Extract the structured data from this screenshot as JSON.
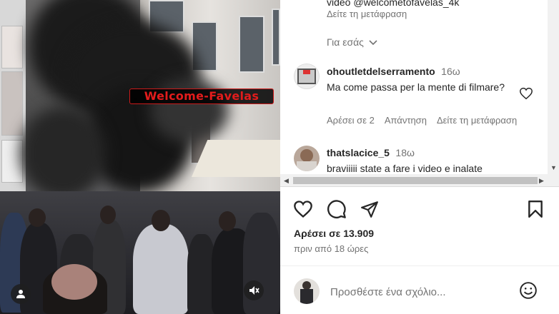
{
  "video": {
    "watermark": "Welcome-Favelas"
  },
  "caption": {
    "tail_text": "video @welcometofavelas_4k",
    "see_translation": "Δείτε τη μετάφραση"
  },
  "for_you": {
    "label": "Για εσάς"
  },
  "comments": [
    {
      "username": "ohoutletdelserramento",
      "time": "16ω",
      "text": "Ma come passa per la mente di filmare?",
      "likes": "Αρέσει σε 2",
      "reply": "Απάντηση",
      "see_translation": "Δείτε τη μετάφραση"
    },
    {
      "username": "thatslacice_5",
      "time": "18ω",
      "text": "braviiiii state a fare i video e inalate"
    }
  ],
  "post": {
    "likes_text": "Αρέσει σε 13.909",
    "posted_ago": "πριν από 18 ώρες"
  },
  "add_comment": {
    "placeholder": "Προσθέστε ένα σχόλιο..."
  }
}
